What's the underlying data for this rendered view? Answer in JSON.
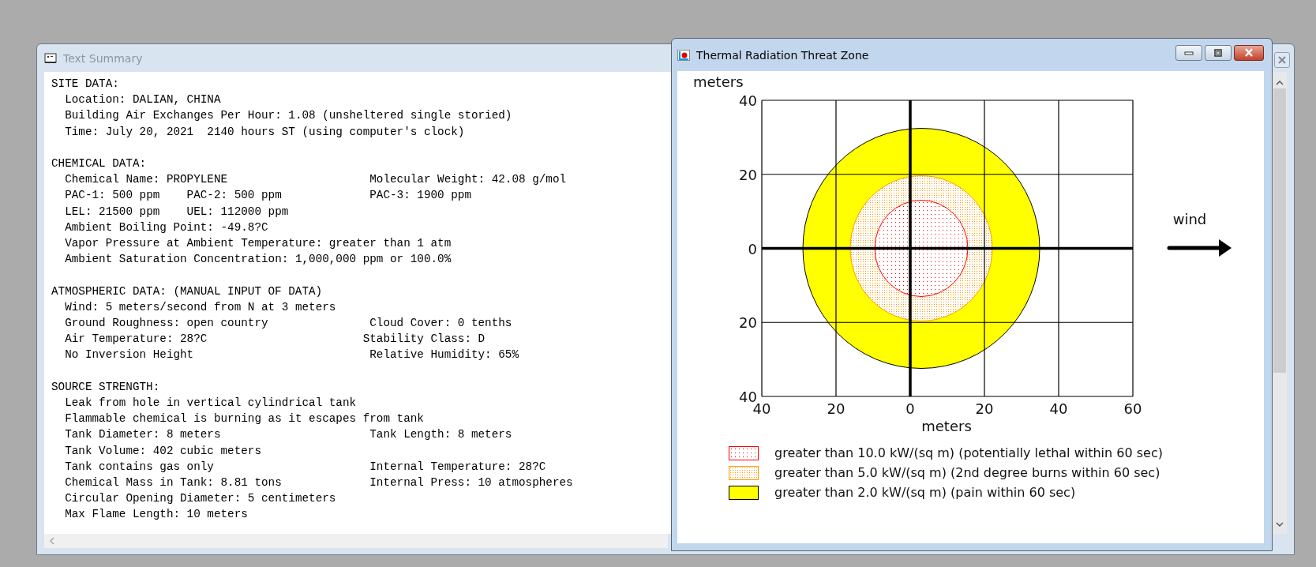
{
  "text_summary_window": {
    "title": "Text Summary",
    "active": false,
    "sections": [
      {
        "heading": "SITE DATA:",
        "lines": [
          "Location: DALIAN, CHINA",
          "Building Air Exchanges Per Hour: 1.08 (unsheltered single storied)",
          "Time: July 20, 2021  2140 hours ST (using computer's clock)"
        ]
      },
      {
        "heading": "CHEMICAL DATA:",
        "lines": [
          "Chemical Name: PROPYLENE                     Molecular Weight: 42.08 g/mol",
          "PAC-1: 500 ppm    PAC-2: 500 ppm             PAC-3: 1900 ppm",
          "LEL: 21500 ppm    UEL: 112000 ppm",
          "Ambient Boiling Point: -49.8?C",
          "Vapor Pressure at Ambient Temperature: greater than 1 atm",
          "Ambient Saturation Concentration: 1,000,000 ppm or 100.0%"
        ]
      },
      {
        "heading": "ATMOSPHERIC DATA: (MANUAL INPUT OF DATA)",
        "lines": [
          "Wind: 5 meters/second from N at 3 meters",
          "Ground Roughness: open country               Cloud Cover: 0 tenths",
          "Air Temperature: 28?C                       Stability Class: D",
          "No Inversion Height                          Relative Humidity: 65%"
        ]
      },
      {
        "heading": "SOURCE STRENGTH:",
        "lines": [
          "Leak from hole in vertical cylindrical tank",
          "Flammable chemical is burning as it escapes from tank",
          "Tank Diameter: 8 meters                      Tank Length: 8 meters",
          "Tank Volume: 402 cubic meters",
          "Tank contains gas only                       Internal Temperature: 28?C",
          "Chemical Mass in Tank: 8.81 tons             Internal Press: 10 atmospheres",
          "Circular Opening Diameter: 5 centimeters",
          "Max Flame Length: 10 meters"
        ]
      }
    ]
  },
  "threat_zone_window": {
    "title": "Thermal Radiation Threat Zone",
    "active": true,
    "plot": {
      "ylabel": "meters",
      "xlabel": "meters",
      "yticks": [
        "40",
        "20",
        "0",
        "20",
        "40"
      ],
      "xticks": [
        "40",
        "20",
        "0",
        "20",
        "40",
        "60"
      ],
      "wind_label": "wind"
    },
    "legend": [
      {
        "label": "greater than 10.0 kW/(sq m) (potentially lethal within 60 sec)",
        "kind": "dotted",
        "color": "#ff0000"
      },
      {
        "label": "greater than 5.0 kW/(sq m) (2nd degree burns within 60 sec)",
        "kind": "dotted",
        "color": "#ff9900"
      },
      {
        "label": "greater than 2.0 kW/(sq m) (pain within 60 sec)",
        "kind": "solid",
        "color": "#ffff00"
      }
    ]
  }
}
